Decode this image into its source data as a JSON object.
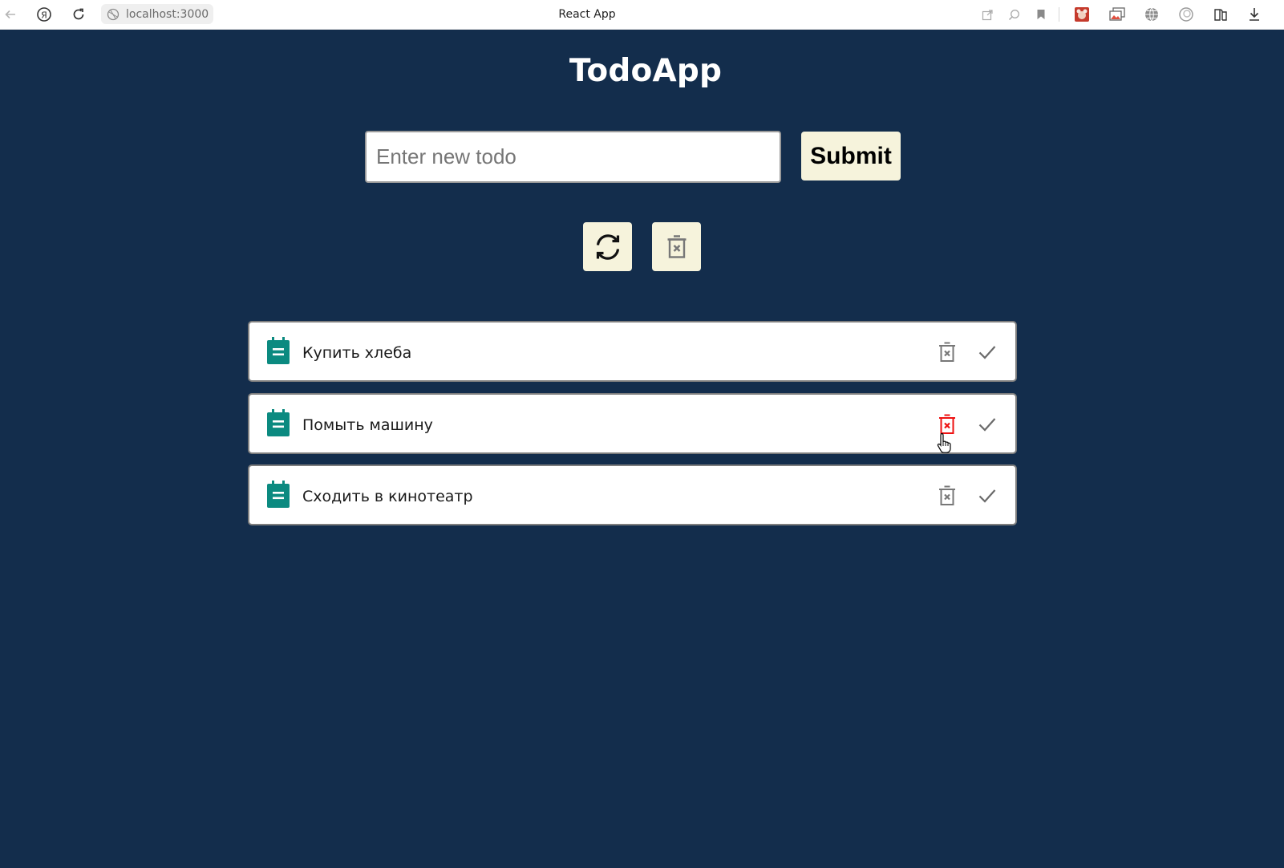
{
  "browser": {
    "address": "localhost:3000",
    "window_title": "React App"
  },
  "app": {
    "title": "TodoApp",
    "input": {
      "placeholder": "Enter new todo",
      "value": ""
    },
    "submit_label": "Submit"
  },
  "todos": [
    {
      "text": "Купить хлеба",
      "delete_hovered": false
    },
    {
      "text": "Помыть машину",
      "delete_hovered": true
    },
    {
      "text": "Сходить в кинотеатр",
      "delete_hovered": false
    }
  ],
  "colors": {
    "background": "#132d4c",
    "button_bg": "#f6f3dc",
    "doc_icon": "#0b8a80",
    "delete_hover": "#ee1111",
    "icon_gray": "#777777"
  },
  "icons": {
    "refresh": "refresh-icon",
    "clear_all": "trash-x-icon",
    "todo": "document-icon",
    "delete": "trash-x-icon",
    "complete": "checkmark-icon"
  }
}
